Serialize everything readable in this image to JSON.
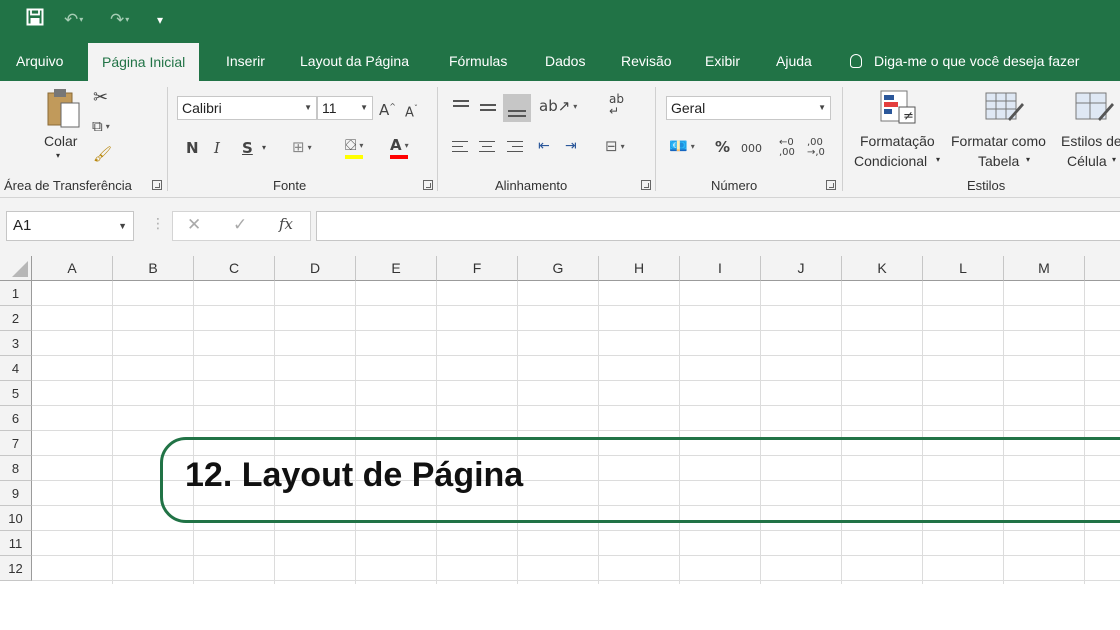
{
  "quick_access": {
    "save_icon": "save-icon",
    "undo_icon": "undo-icon",
    "redo_icon": "redo-icon",
    "customize_icon": "customize-icon"
  },
  "tabs": [
    {
      "label": "Arquivo"
    },
    {
      "label": "Página Inicial",
      "active": true
    },
    {
      "label": "Inserir"
    },
    {
      "label": "Layout da Página"
    },
    {
      "label": "Fórmulas"
    },
    {
      "label": "Dados"
    },
    {
      "label": "Revisão"
    },
    {
      "label": "Exibir"
    },
    {
      "label": "Ajuda"
    }
  ],
  "tell_me": "Diga-me o que você deseja fazer",
  "ribbon": {
    "clipboard": {
      "paste_label": "Colar",
      "group_label": "Área de Transferência"
    },
    "font": {
      "font_name": "Calibri",
      "font_size": "11",
      "bold": "N",
      "italic": "I",
      "underline": "S",
      "group_label": "Fonte"
    },
    "alignment": {
      "group_label": "Alinhamento"
    },
    "number": {
      "format": "Geral",
      "percent": "%",
      "thousands": "000",
      "group_label": "Número"
    },
    "styles": {
      "conditional_line1": "Formatação",
      "conditional_line2": "Condicional",
      "table_line1": "Formatar como",
      "table_line2": "Tabela",
      "cell_line1": "Estilos de",
      "cell_line2": "Célula",
      "group_label": "Estilos"
    }
  },
  "formula_bar": {
    "name_box": "A1",
    "fx": "fx",
    "value": ""
  },
  "columns": [
    "A",
    "B",
    "C",
    "D",
    "E",
    "F",
    "G",
    "H",
    "I",
    "J",
    "K",
    "L",
    "M"
  ],
  "rows": [
    "1",
    "2",
    "3",
    "4",
    "5",
    "6",
    "7",
    "8",
    "9",
    "10",
    "11",
    "12"
  ],
  "banner": {
    "text": "12. Layout de Página"
  },
  "colors": {
    "accent": "#217346",
    "ribbon_bg": "#f3f3f3"
  }
}
